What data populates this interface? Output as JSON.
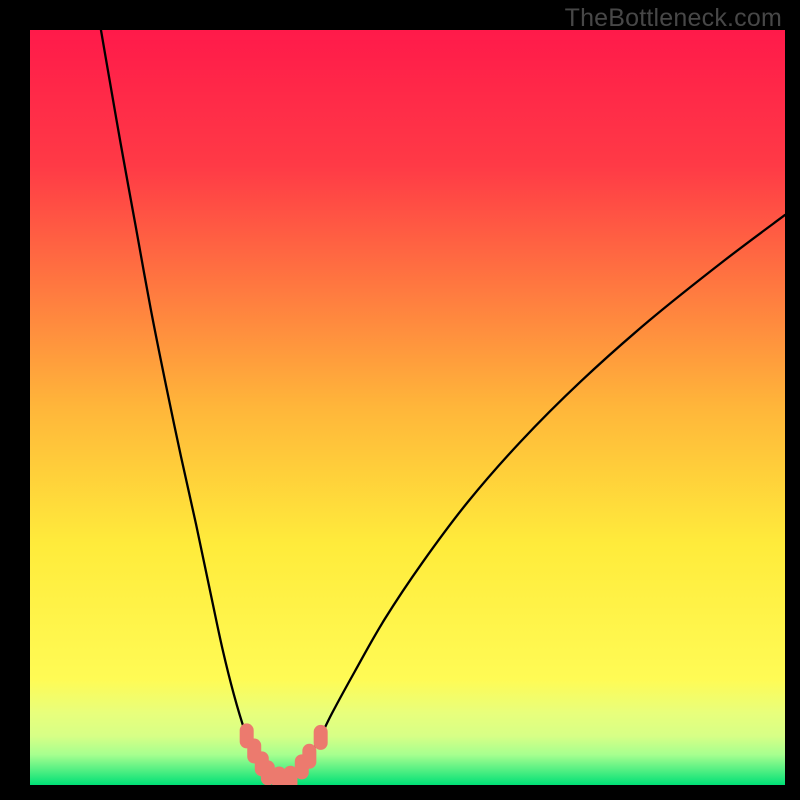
{
  "watermark": "TheBottleneck.com",
  "chart_data": {
    "type": "line",
    "title": "",
    "xlabel": "",
    "ylabel": "",
    "xlim": [
      0,
      100
    ],
    "ylim": [
      0,
      100
    ],
    "grid": false,
    "legend": false,
    "background_gradient": {
      "top": "#FF1A4A",
      "mid_upper": "#FFB63A",
      "mid": "#FFEB3B",
      "lower": "#E8FF7C",
      "bottom": "#00E076"
    },
    "series": [
      {
        "name": "curve",
        "x": [
          9.4,
          10,
          12,
          14,
          16,
          18,
          20,
          22,
          24,
          25.5,
          27,
          28.5,
          29.5,
          30.5,
          31.5,
          32,
          33,
          34,
          35,
          36,
          38,
          40,
          43,
          47,
          52,
          58,
          65,
          73,
          82,
          92,
          100
        ],
        "y": [
          100,
          96.5,
          85,
          74,
          63,
          53,
          43.5,
          34.5,
          25,
          18,
          12,
          7,
          4.5,
          2.8,
          1.5,
          1,
          0.8,
          0.8,
          1.3,
          2.4,
          5.5,
          9.5,
          15,
          22,
          29.5,
          37.5,
          45.5,
          53.5,
          61.5,
          69.5,
          75.5
        ]
      },
      {
        "name": "markers",
        "x": [
          28.7,
          29.7,
          30.7,
          31.5,
          33.0,
          34.5,
          36.0,
          37.0,
          38.5
        ],
        "y": [
          6.5,
          4.5,
          2.8,
          1.6,
          0.8,
          0.9,
          2.4,
          3.8,
          6.3
        ]
      }
    ]
  }
}
